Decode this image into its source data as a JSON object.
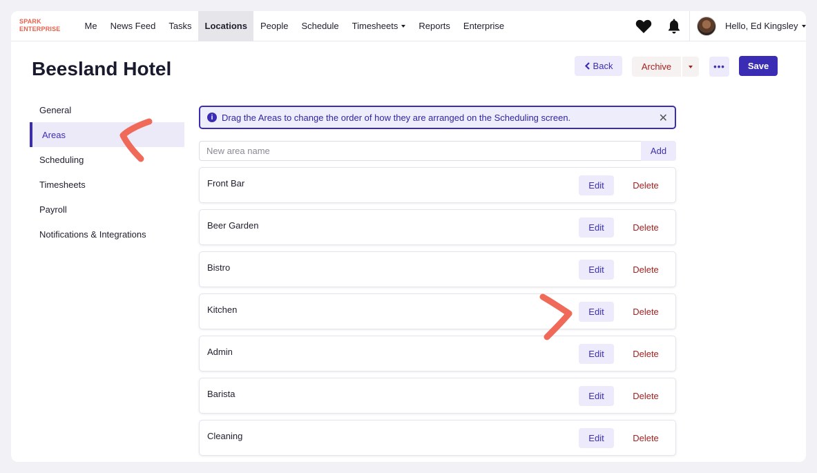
{
  "brand": {
    "line1": "SPARK",
    "line2": "ENTERPRISE"
  },
  "nav": {
    "items": [
      {
        "label": "Me",
        "active": false,
        "dropdown": false
      },
      {
        "label": "News Feed",
        "active": false,
        "dropdown": false
      },
      {
        "label": "Tasks",
        "active": false,
        "dropdown": false
      },
      {
        "label": "Locations",
        "active": true,
        "dropdown": false
      },
      {
        "label": "People",
        "active": false,
        "dropdown": false
      },
      {
        "label": "Schedule",
        "active": false,
        "dropdown": false
      },
      {
        "label": "Timesheets",
        "active": false,
        "dropdown": true
      },
      {
        "label": "Reports",
        "active": false,
        "dropdown": false
      },
      {
        "label": "Enterprise",
        "active": false,
        "dropdown": false
      }
    ],
    "greeting": "Hello, Ed Kingsley"
  },
  "header": {
    "title": "Beesland Hotel",
    "back_label": "Back",
    "archive_label": "Archive",
    "more_label": "•••",
    "save_label": "Save"
  },
  "sidebar": {
    "items": [
      {
        "label": "General",
        "active": false
      },
      {
        "label": "Areas",
        "active": true
      },
      {
        "label": "Scheduling",
        "active": false
      },
      {
        "label": "Timesheets",
        "active": false
      },
      {
        "label": "Payroll",
        "active": false
      },
      {
        "label": "Notifications & Integrations",
        "active": false
      }
    ]
  },
  "areas": {
    "banner": "Drag the Areas to change the order of how they are arranged on the Scheduling screen.",
    "input_placeholder": "New area name",
    "add_label": "Add",
    "edit_label": "Edit",
    "delete_label": "Delete",
    "list": [
      "Front Bar",
      "Beer Garden",
      "Bistro",
      "Kitchen",
      "Admin",
      "Barista",
      "Cleaning"
    ]
  },
  "colors": {
    "accent": "#3b2db3",
    "danger": "#a31f1f",
    "brand": "#e8604c",
    "annotation": "#f06a5a"
  }
}
